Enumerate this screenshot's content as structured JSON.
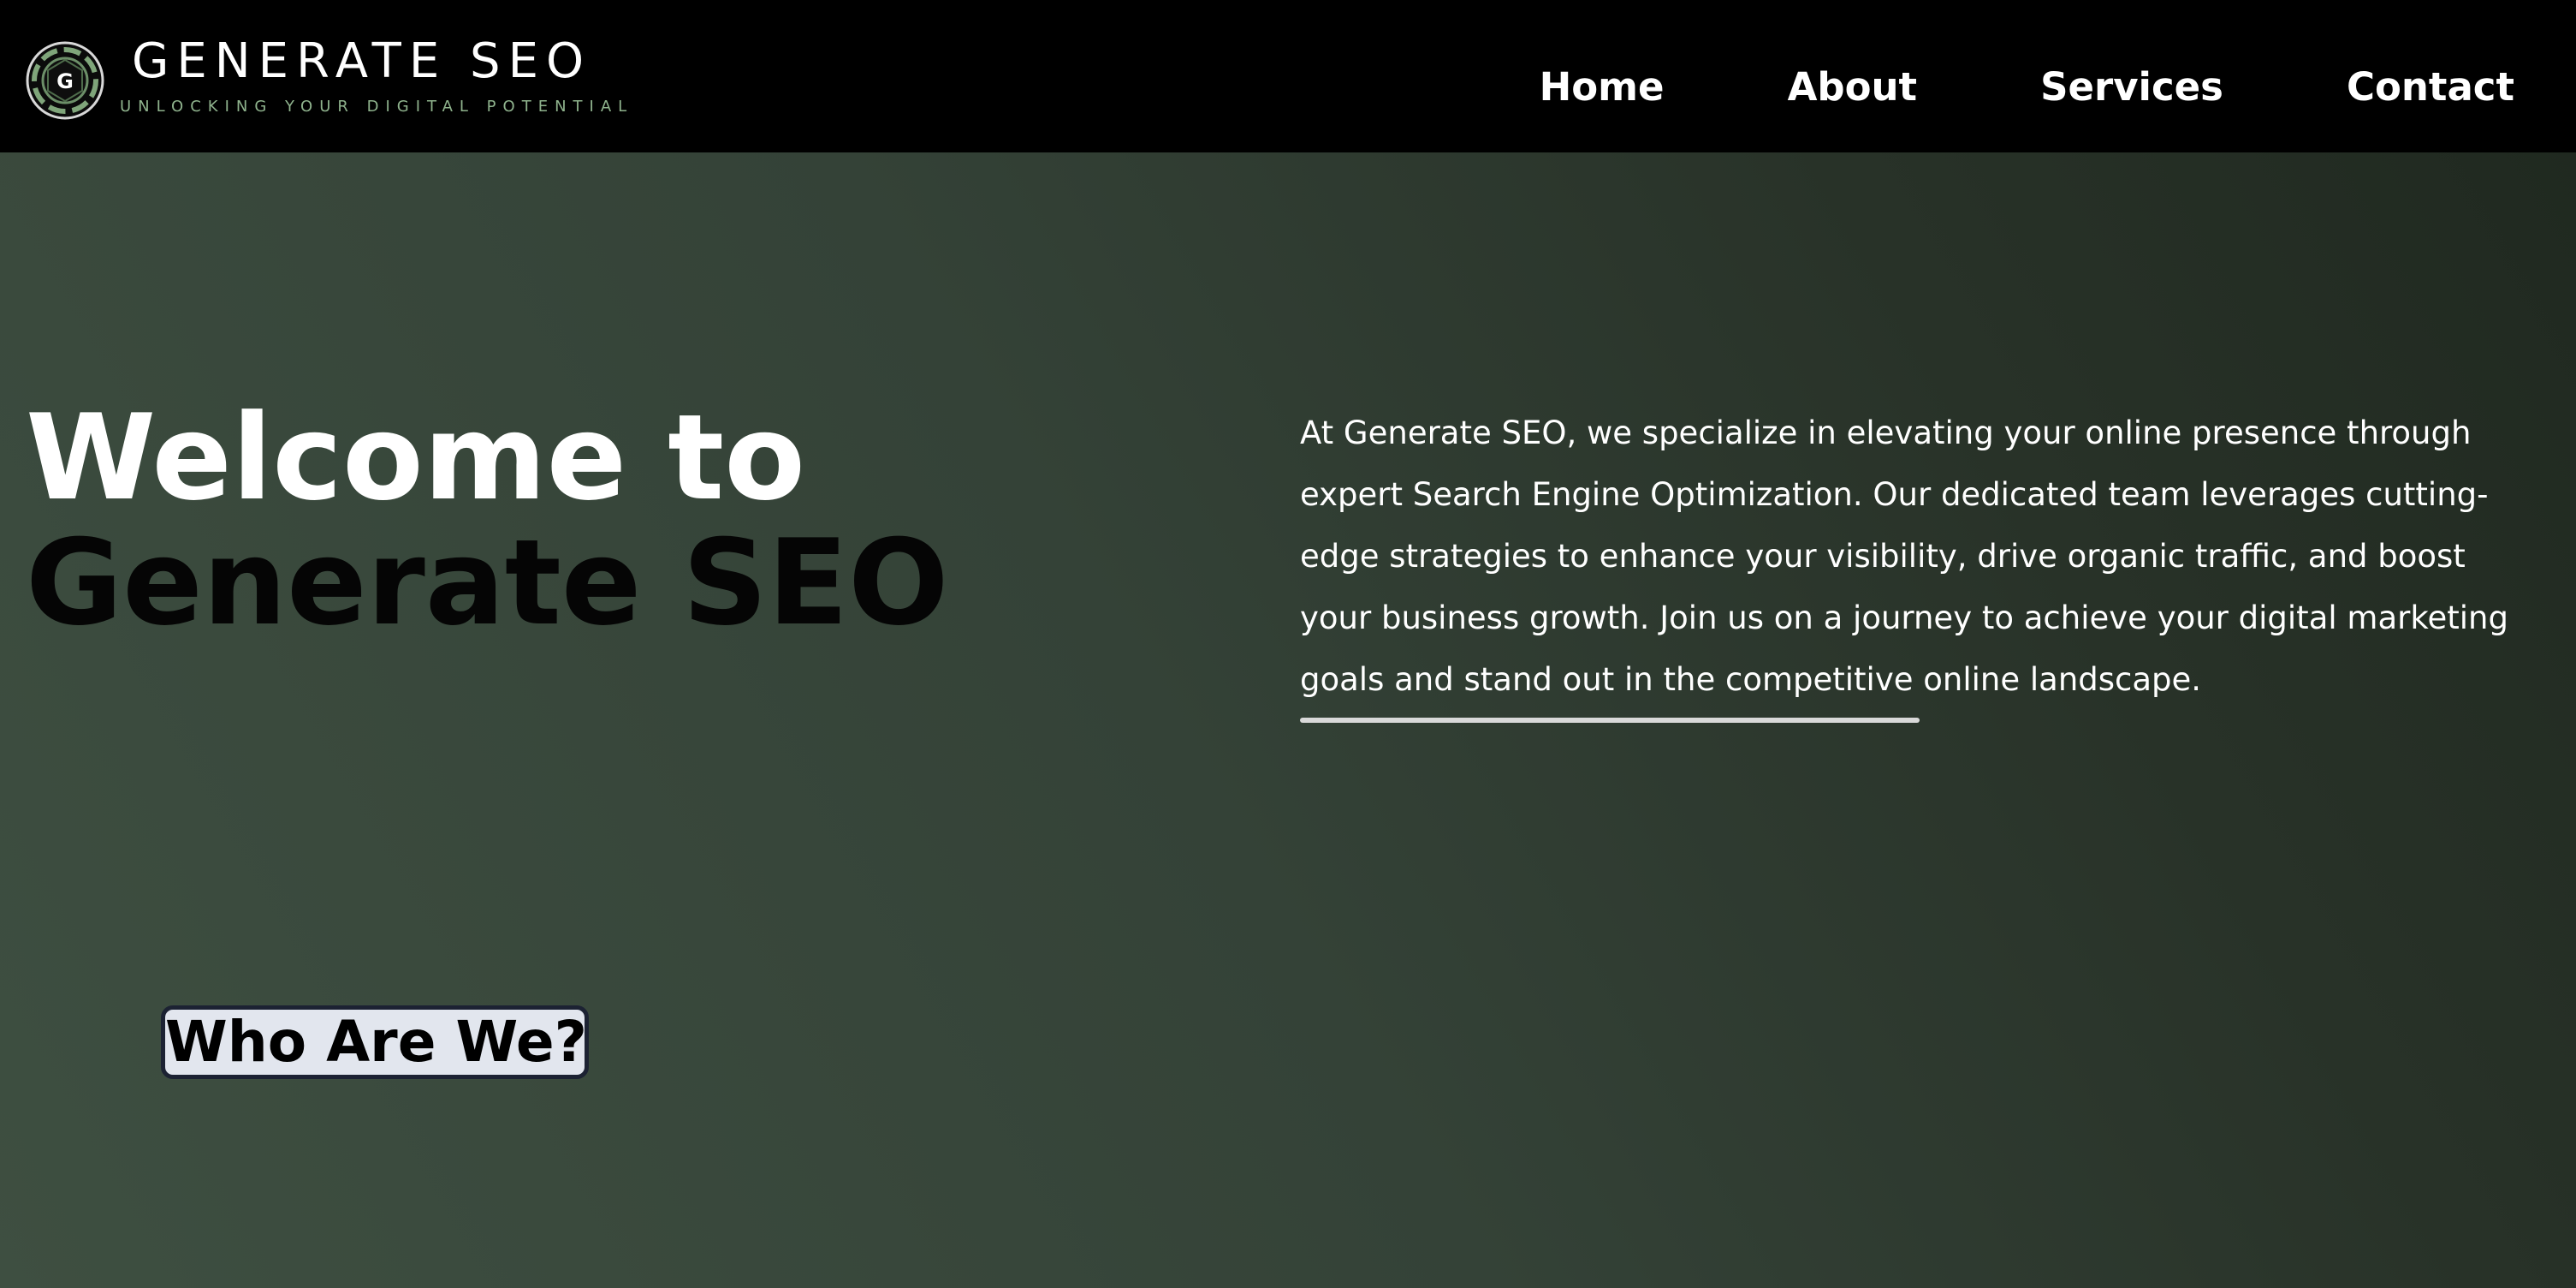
{
  "header": {
    "brand": {
      "logo_icon": "generate-seo-logo-icon",
      "logo_letter": "G",
      "title": "GENERATE SEO",
      "tagline": "UNLOCKING YOUR DIGITAL POTENTIAL"
    },
    "nav": [
      {
        "label": "Home"
      },
      {
        "label": "About"
      },
      {
        "label": "Services"
      },
      {
        "label": "Contact"
      }
    ]
  },
  "hero": {
    "heading_line1": "Welcome to",
    "heading_line2": "Generate SEO",
    "intro": "At Generate SEO, we specialize in elevating your online presence through expert Search Engine Optimization. Our dedicated team leverages cutting-edge strategies to enhance your visibility, drive organic traffic, and boost your business growth. Join us on a journey to achieve your digital marketing goals and stand out in the competitive online landscape.",
    "cta_label": "Who Are We?"
  },
  "colors": {
    "header_bg": "#000000",
    "accent_green": "#8fb38d",
    "hero_bg_light": "#3e4f41",
    "hero_bg_dark": "#1f281f",
    "button_bg": "#e2e6ee",
    "button_border": "#1c2233"
  }
}
